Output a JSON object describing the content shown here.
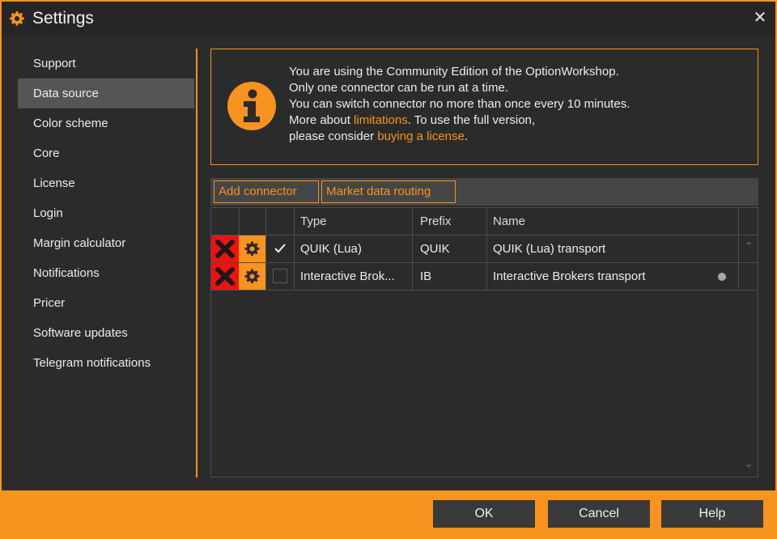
{
  "window": {
    "title": "Settings",
    "close_label": "✕"
  },
  "sidebar": {
    "items": [
      {
        "label": "Support"
      },
      {
        "label": "Data source",
        "active": true
      },
      {
        "label": "Color scheme"
      },
      {
        "label": "Core"
      },
      {
        "label": "License"
      },
      {
        "label": "Login"
      },
      {
        "label": "Margin calculator"
      },
      {
        "label": "Notifications"
      },
      {
        "label": "Pricer"
      },
      {
        "label": "Software updates"
      },
      {
        "label": "Telegram notifications"
      }
    ]
  },
  "info": {
    "line1": "You are using the Community Edition of the OptionWorkshop.",
    "line2": "Only one connector can be run at a time.",
    "line3": "You can switch connector no more than once every 10 minutes.",
    "line4_prefix": "More about ",
    "line4_link": "limitations",
    "line4_suffix": ". To use the full version,",
    "line5_prefix": "please consider ",
    "line5_link": "buying a license",
    "line5_suffix": "."
  },
  "toolbar": {
    "add_connector": "Add connector",
    "market_data_routing": "Market data routing"
  },
  "grid": {
    "columns": {
      "type": "Type",
      "prefix": "Prefix",
      "name": "Name"
    },
    "rows": [
      {
        "checked": true,
        "type": "QUIK (Lua)",
        "prefix": "QUIK",
        "name": "QUIK (Lua) transport",
        "status": ""
      },
      {
        "checked": false,
        "type": "Interactive Brok...",
        "prefix": "IB",
        "name": "Interactive Brokers transport",
        "status": "●"
      }
    ]
  },
  "footer": {
    "ok": "OK",
    "cancel": "Cancel",
    "help": "Help"
  },
  "colors": {
    "accent": "#f7931e",
    "delete": "#ee1111",
    "background": "#2b2b2b",
    "selected": "#555555"
  }
}
